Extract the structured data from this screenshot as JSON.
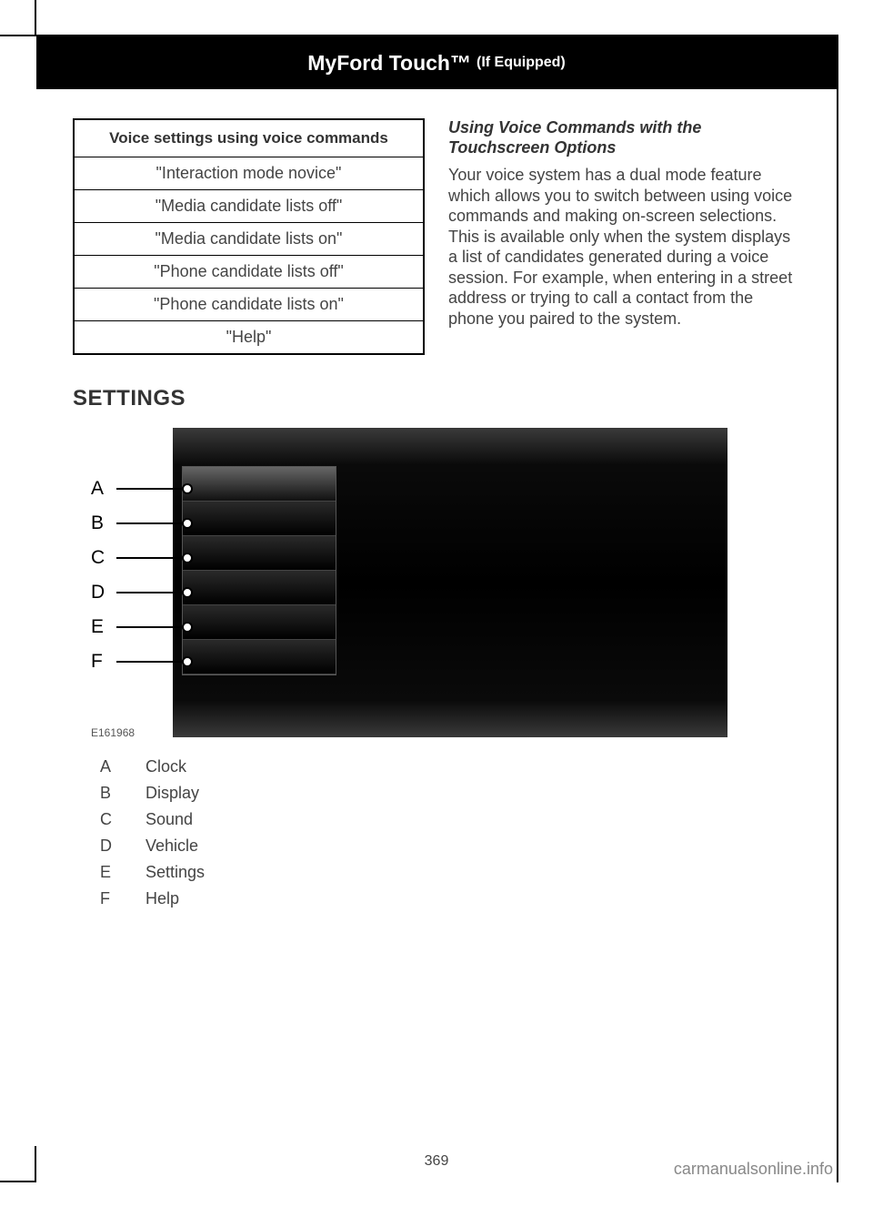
{
  "header": {
    "title": "MyFord Touch™",
    "subtitle": "(If Equipped)"
  },
  "voice_table": {
    "header": "Voice settings using voice commands",
    "rows": [
      "\"Interaction mode novice\"",
      "\"Media candidate lists off\"",
      "\"Media candidate lists on\"",
      "\"Phone candidate lists off\"",
      "\"Phone candidate lists on\"",
      "\"Help\""
    ]
  },
  "right_col": {
    "subheading": "Using Voice Commands with the Touchscreen Options",
    "body": "Your voice system has a dual mode feature which allows you to switch between using voice commands and making on-screen selections. This is available only when the system displays a list of candidates generated during a voice session. For example, when entering in a street address or trying to call a contact from the phone you paired to the system."
  },
  "settings_heading": "SETTINGS",
  "figure": {
    "id": "E161968",
    "callouts": [
      "A",
      "B",
      "C",
      "D",
      "E",
      "F"
    ]
  },
  "legend": [
    {
      "k": "A",
      "v": "Clock"
    },
    {
      "k": "B",
      "v": "Display"
    },
    {
      "k": "C",
      "v": "Sound"
    },
    {
      "k": "D",
      "v": "Vehicle"
    },
    {
      "k": "E",
      "v": "Settings"
    },
    {
      "k": "F",
      "v": "Help"
    }
  ],
  "page_number": "369",
  "watermark": "carmanualsonline.info"
}
